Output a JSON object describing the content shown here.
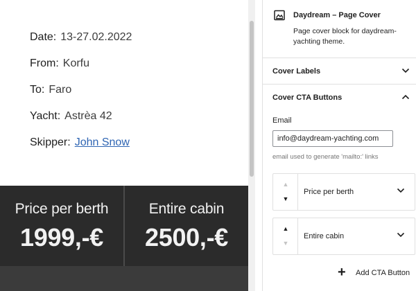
{
  "trip": {
    "date_label": "Date:",
    "date_value": "13-27.02.2022",
    "from_label": "From:",
    "from_value": "Korfu",
    "to_label": "To:",
    "to_value": "Faro",
    "yacht_label": "Yacht:",
    "yacht_value": "Astrèa 42",
    "skipper_label": "Skipper:",
    "skipper_value": "John Snow"
  },
  "cta_preview": [
    {
      "title": "Price per berth",
      "price": "1999,-€"
    },
    {
      "title": "Entire cabin",
      "price": "2500,-€"
    }
  ],
  "sidebar": {
    "block_icon": "cover-image-icon",
    "block_title": "Daydream – Page Cover",
    "block_description": "Page cover block for daydream-yachting theme.",
    "panels": {
      "cover_labels": {
        "title": "Cover Labels",
        "expanded": false
      },
      "cover_cta": {
        "title": "Cover CTA Buttons",
        "expanded": true
      }
    },
    "email": {
      "label": "Email",
      "value": "info@daydream-yachting.com",
      "help": "email used to generate 'mailto:' links"
    },
    "cta_items": [
      {
        "label": "Price per berth",
        "move_up_enabled": false,
        "move_down_enabled": true
      },
      {
        "label": "Entire cabin",
        "move_up_enabled": true,
        "move_down_enabled": false
      }
    ],
    "add_button_label": "Add CTA Button"
  },
  "colors": {
    "link": "#2f65b3",
    "cta_card_bg": "#2b2b2b",
    "cta_area_bg": "#3b3b3b",
    "border": "#e0e0e0"
  }
}
